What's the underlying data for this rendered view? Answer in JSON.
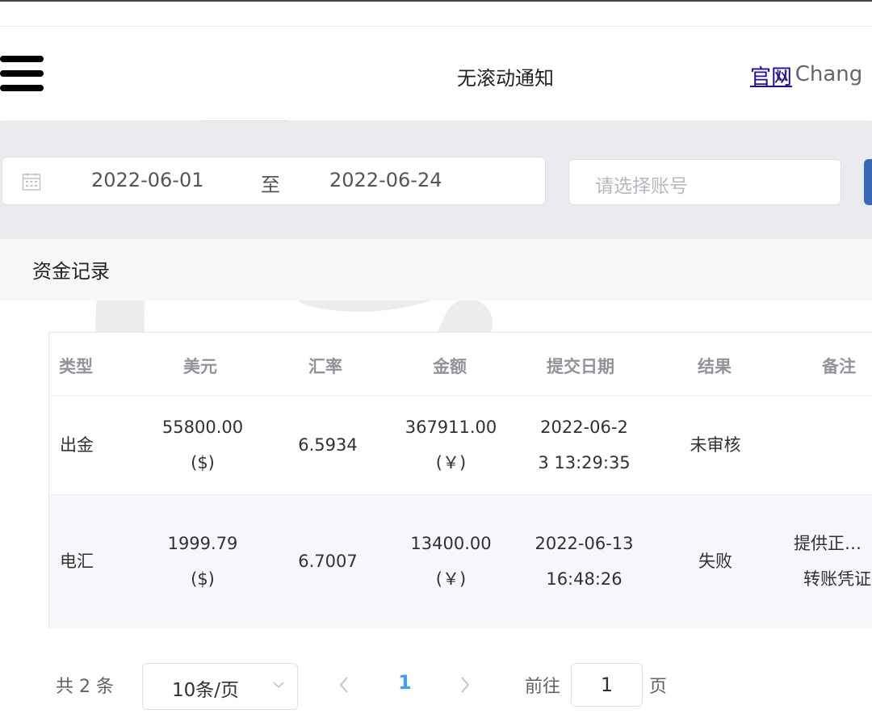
{
  "header": {
    "notice": "无滚动通知",
    "site_link": "官网",
    "username": "u Chang"
  },
  "filters": {
    "date_start": "2022-06-01",
    "date_separator": "至",
    "date_end": "2022-06-24",
    "account_placeholder": "请选择账号"
  },
  "card": {
    "title": "资金记录"
  },
  "table": {
    "columns": [
      "类型",
      "美元",
      "汇率",
      "金额",
      "提交日期",
      "结果",
      "备注"
    ],
    "rows": [
      {
        "type": "出金",
        "usd": "55800.00",
        "usd_unit": "($)",
        "rate": "6.5934",
        "amount": "367911.00",
        "amount_unit": "(￥)",
        "date_line1": "2022-06-2",
        "date_line2": "3 13:29:35",
        "result": "未审核",
        "remark_line1": "",
        "remark_line2": ""
      },
      {
        "type": "电汇",
        "usd": "1999.79",
        "usd_unit": "($)",
        "rate": "6.7007",
        "amount": "13400.00",
        "amount_unit": "(￥)",
        "date_line1": "2022-06-13",
        "date_line2": "16:48:26",
        "result": "失败",
        "remark_line1": "提供正…",
        "remark_line2": "转账凭证"
      }
    ]
  },
  "pagination": {
    "total": "共 2 条",
    "page_size": "10条/页",
    "current_page": "1",
    "goto_label": "前往",
    "goto_value": "1",
    "goto_unit": "页"
  },
  "colors": {
    "accent": "#409eff",
    "button": "#3a68b8",
    "filter_bg": "#e9ebef"
  }
}
